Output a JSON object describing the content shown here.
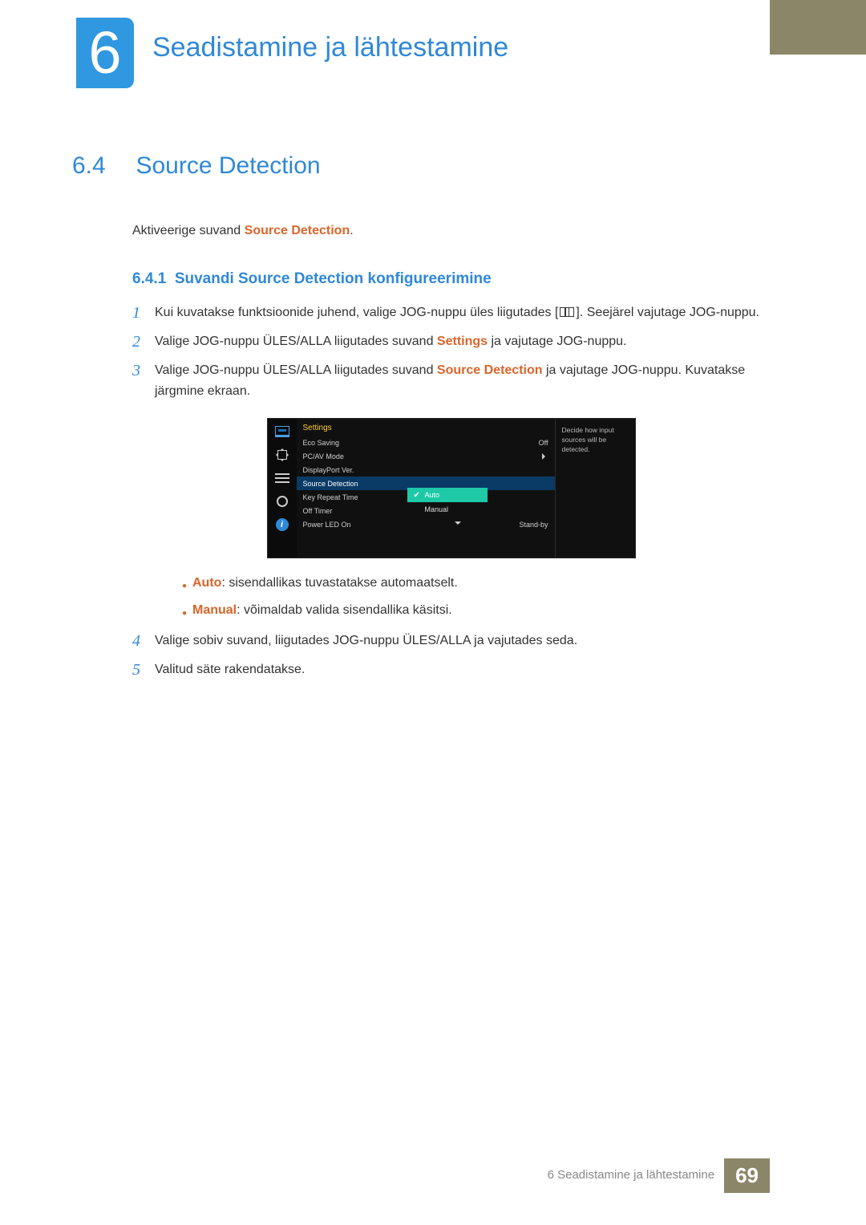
{
  "chapter": {
    "number": "6",
    "title": "Seadistamine ja lähtestamine"
  },
  "section": {
    "number": "6.4",
    "title": "Source Detection"
  },
  "intro": {
    "prefix": "Aktiveerige suvand ",
    "highlight": "Source Detection",
    "suffix": "."
  },
  "subsection": {
    "number": "6.4.1",
    "title": "Suvandi Source Detection konfigureerimine"
  },
  "steps": {
    "s1": {
      "n": "1",
      "text_a": "Kui kuvatakse funktsioonide juhend, valige JOG-nuppu üles liigutades [",
      "text_b": "]. Seejärel vajutage JOG-nuppu."
    },
    "s2": {
      "n": "2",
      "prefix": "Valige JOG-nuppu ÜLES/ALLA liigutades suvand ",
      "hl": "Settings",
      "suffix": " ja vajutage JOG-nuppu."
    },
    "s3": {
      "n": "3",
      "prefix": "Valige JOG-nuppu ÜLES/ALLA liigutades suvand ",
      "hl": "Source Detection",
      "suffix": " ja vajutage JOG-nuppu. Kuvatakse järgmine ekraan."
    },
    "s4": {
      "n": "4",
      "text": "Valige sobiv suvand, liigutades JOG-nuppu ÜLES/ALLA ja vajutades seda."
    },
    "s5": {
      "n": "5",
      "text": "Valitud säte rakendatakse."
    }
  },
  "osd": {
    "title": "Settings",
    "hint": "Decide how input sources will be detected.",
    "items": {
      "eco": {
        "label": "Eco Saving",
        "value": "Off"
      },
      "pcav": {
        "label": "PC/AV Mode"
      },
      "dp": {
        "label": "DisplayPort Ver."
      },
      "src": {
        "label": "Source Detection"
      },
      "key": {
        "label": "Key Repeat Time"
      },
      "off": {
        "label": "Off Timer"
      },
      "led": {
        "label": "Power LED On",
        "value": "Stand-by"
      }
    },
    "submenu": {
      "auto": "Auto",
      "manual": "Manual"
    }
  },
  "bullets": {
    "b1": {
      "hl": "Auto",
      "text": ": sisendallikas tuvastatakse automaatselt."
    },
    "b2": {
      "hl": "Manual",
      "text": ": võimaldab valida sisendallika käsitsi."
    }
  },
  "footer": {
    "text": "6 Seadistamine ja lähtestamine",
    "page": "69"
  }
}
